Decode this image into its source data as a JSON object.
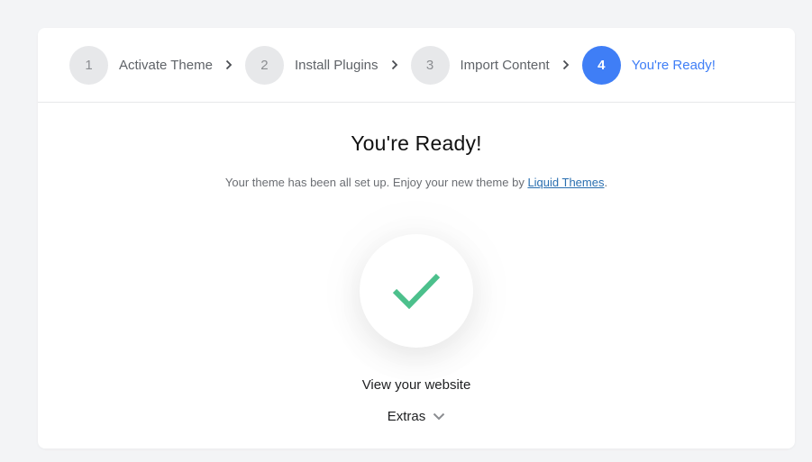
{
  "steps": [
    {
      "number": "1",
      "label": "Activate Theme"
    },
    {
      "number": "2",
      "label": "Install Plugins"
    },
    {
      "number": "3",
      "label": "Import Content"
    },
    {
      "number": "4",
      "label": "You're Ready!"
    }
  ],
  "main": {
    "title": "You're Ready!",
    "subtitle_prefix": "Your theme has been all set up. Enjoy your new theme by ",
    "subtitle_link": "Liquid Themes",
    "subtitle_suffix": ".",
    "view_website": "View your website",
    "extras": "Extras"
  },
  "icons": {
    "check": "checkmark-icon",
    "chevron": "chevron-right-icon",
    "extras_chevron": "chevron-down-icon"
  },
  "colors": {
    "accent": "#3f7ef6",
    "check": "#4cc08c",
    "link": "#2a6fb0"
  }
}
